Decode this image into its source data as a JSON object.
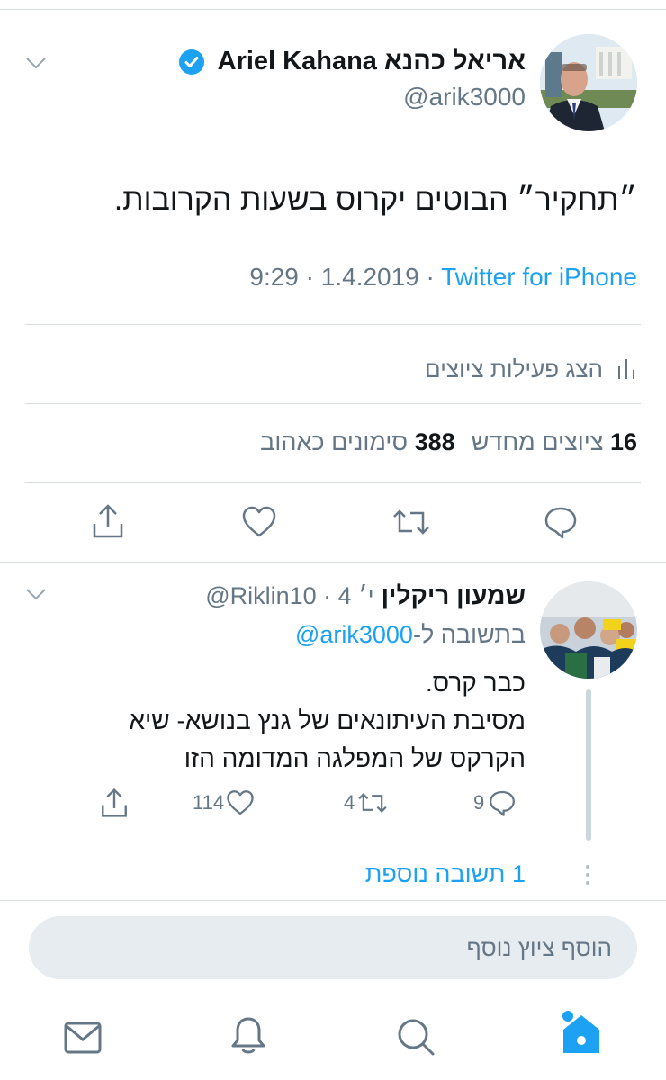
{
  "tweet": {
    "author_name": "אריאל כהנא Ariel Kahana",
    "handle": "@arik3000",
    "text": "״תחקיר״ הבוטים יקרוס בשעות הקרובות.",
    "time": "9:29 · 1.4.2019 · ",
    "source": "Twitter for iPhone",
    "activity_label": "הצג פעילות ציוצים",
    "retweets_count": "16",
    "retweets_label": "ציוצים מחדש",
    "likes_count": "388",
    "likes_label": "סימונים כאהוב"
  },
  "reply": {
    "author_name": "שמעון ריקלין",
    "handle_time": "@Riklin10 · 4 י׳",
    "replying_prefix": "בתשובה ל-",
    "replying_handle": "@arik3000",
    "line1": "כבר קרס.",
    "line2": "מסיבת העיתונאים של גנץ בנושא- שיא",
    "line3": "הקרקס של המפלגה המדומה הזו",
    "replies_count": "9",
    "retweets_count": "4",
    "likes_count": "114",
    "more_replies": "1 תשובה נוספת"
  },
  "compose": {
    "placeholder": "הוסף ציוץ נוסף"
  },
  "icons": {
    "verified": "verified-badge-icon",
    "chevron": "chevron-down-icon",
    "stats": "bar-chart-icon",
    "reply": "comment-bubble-icon",
    "retweet": "retweet-icon",
    "like": "heart-icon",
    "share": "share-icon",
    "mail": "mail-icon",
    "bell": "bell-icon",
    "search": "search-icon",
    "home": "home-icon"
  },
  "colors": {
    "accent": "#1da1f2",
    "text": "#14171a",
    "secondary": "#657786"
  }
}
